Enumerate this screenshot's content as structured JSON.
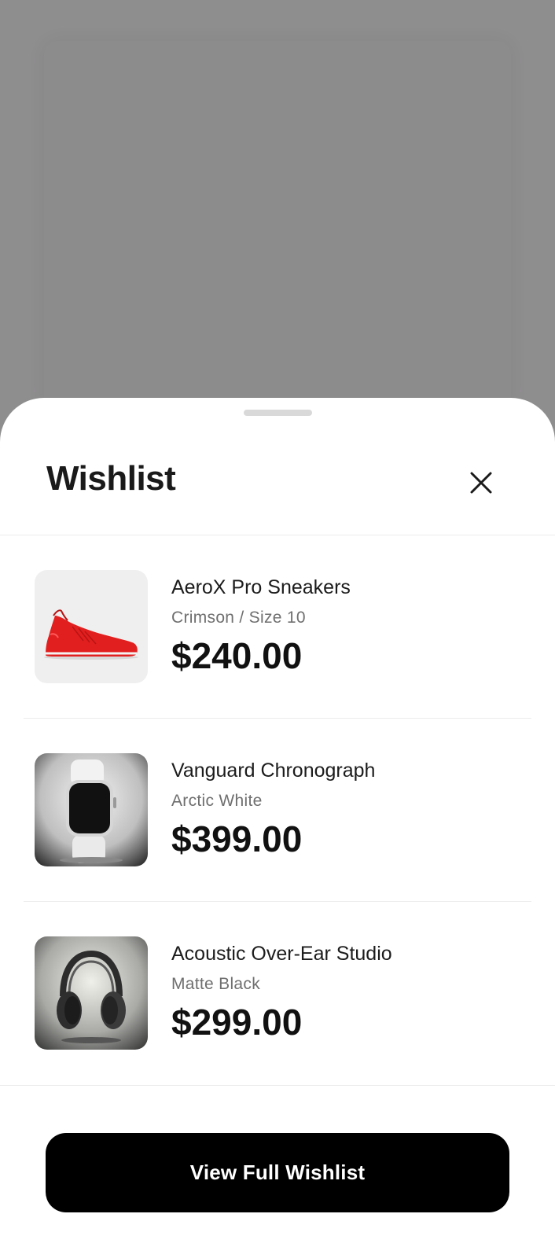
{
  "sheet": {
    "title": "Wishlist",
    "close_icon": "close-icon"
  },
  "items": [
    {
      "name": "AeroX Pro Sneakers",
      "variant": "Crimson / Size 10",
      "price": "$240.00",
      "image": "red-sneaker-image"
    },
    {
      "name": "Vanguard Chronograph",
      "variant": "Arctic White",
      "price": "$399.00",
      "image": "smartwatch-image"
    },
    {
      "name": "Acoustic Over-Ear Studio",
      "variant": "Matte Black",
      "price": "$299.00",
      "image": "headphones-image"
    }
  ],
  "cta": {
    "label": "View Full Wishlist"
  },
  "colors": {
    "backdrop": "#8f8e8f",
    "sheet": "#ffffff",
    "cta_background": "#000000",
    "cta_text": "#ffffff",
    "variant_text": "#6f6f6f"
  }
}
